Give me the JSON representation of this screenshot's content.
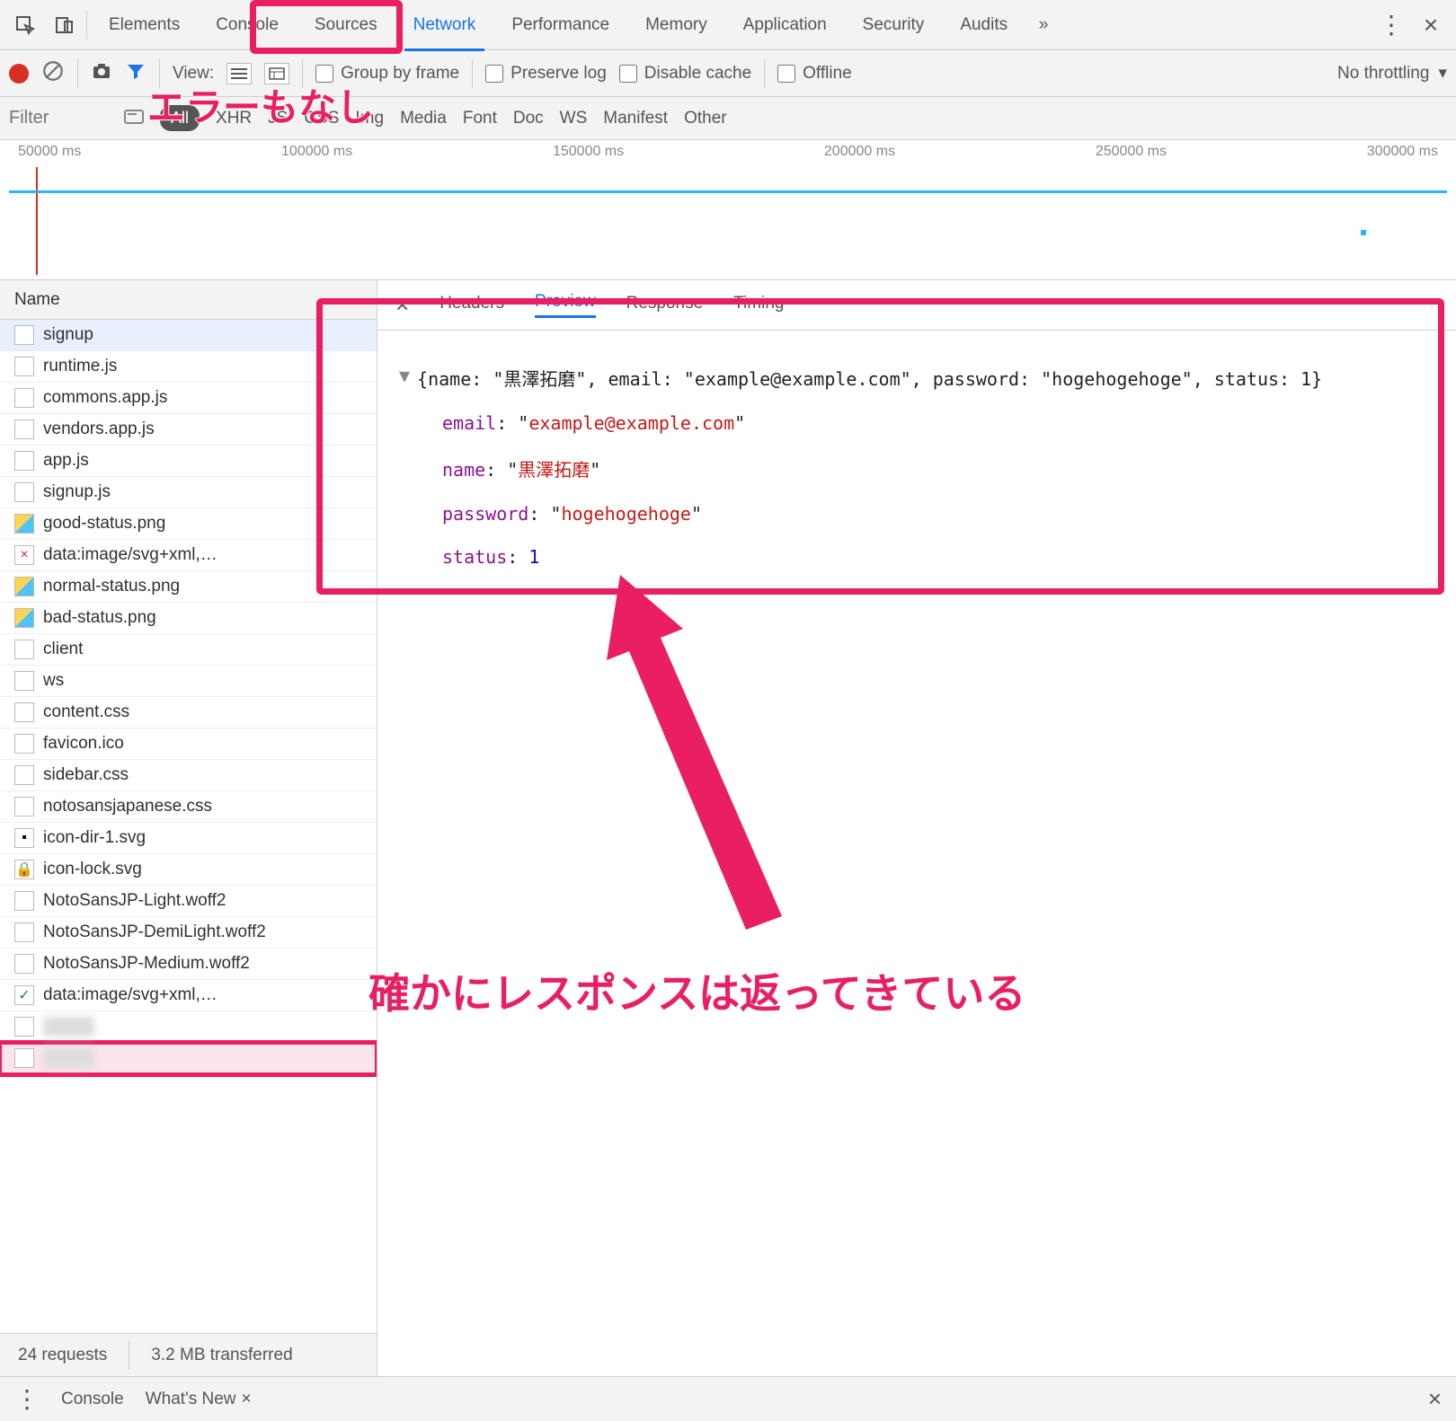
{
  "tabs": {
    "elements": "Elements",
    "console": "Console",
    "sources": "Sources",
    "network": "Network",
    "performance": "Performance",
    "memory": "Memory",
    "application": "Application",
    "security": "Security",
    "audits": "Audits"
  },
  "toolbar": {
    "view_label": "View:",
    "group_by_frame": "Group by frame",
    "preserve_log": "Preserve log",
    "disable_cache": "Disable cache",
    "offline": "Offline",
    "throttling": "No throttling"
  },
  "filter": {
    "placeholder": "Filter",
    "types": {
      "all": "All",
      "xhr": "XHR",
      "js": "JS",
      "css": "CSS",
      "img": "Img",
      "media": "Media",
      "font": "Font",
      "doc": "Doc",
      "ws": "WS",
      "manifest": "Manifest",
      "other": "Other"
    }
  },
  "timeline": {
    "ticks": [
      "50000 ms",
      "100000 ms",
      "150000 ms",
      "200000 ms",
      "250000 ms",
      "300000 ms"
    ]
  },
  "name_header": "Name",
  "requests": [
    {
      "name": "signup",
      "icon": "doc",
      "selected": true
    },
    {
      "name": "runtime.js",
      "icon": "doc"
    },
    {
      "name": "commons.app.js",
      "icon": "doc"
    },
    {
      "name": "vendors.app.js",
      "icon": "doc"
    },
    {
      "name": "app.js",
      "icon": "doc"
    },
    {
      "name": "signup.js",
      "icon": "doc"
    },
    {
      "name": "good-status.png",
      "icon": "img"
    },
    {
      "name": "data:image/svg+xml,…",
      "icon": "x"
    },
    {
      "name": "normal-status.png",
      "icon": "img"
    },
    {
      "name": "bad-status.png",
      "icon": "img"
    },
    {
      "name": "client",
      "icon": "doc"
    },
    {
      "name": "ws",
      "icon": "doc"
    },
    {
      "name": "content.css",
      "icon": "doc"
    },
    {
      "name": "favicon.ico",
      "icon": "doc"
    },
    {
      "name": "sidebar.css",
      "icon": "doc"
    },
    {
      "name": "notosansjapanese.css",
      "icon": "doc"
    },
    {
      "name": "icon-dir-1.svg",
      "icon": "svg"
    },
    {
      "name": "icon-lock.svg",
      "icon": "lock"
    },
    {
      "name": "NotoSansJP-Light.woff2",
      "icon": "doc"
    },
    {
      "name": "NotoSansJP-DemiLight.woff2",
      "icon": "doc"
    },
    {
      "name": "NotoSansJP-Medium.woff2",
      "icon": "doc"
    },
    {
      "name": "data:image/svg+xml,…",
      "icon": "chk"
    },
    {
      "name": "hidden",
      "icon": "doc",
      "blur": true
    },
    {
      "name": "hidden",
      "icon": "doc",
      "blur": true,
      "highlighted": true
    }
  ],
  "detail": {
    "tabs": {
      "headers": "Headers",
      "preview": "Preview",
      "response": "Response",
      "timing": "Timing"
    },
    "summary": "{name: \"黒澤拓磨\", email: \"example@example.com\", password: \"hogehogehoge\", status: 1}",
    "body": {
      "email_k": "email",
      "email_v": "example@example.com",
      "name_k": "name",
      "name_v": "黒澤拓磨",
      "password_k": "password",
      "password_v": "hogehogehoge",
      "status_k": "status",
      "status_v": "1"
    }
  },
  "summary": {
    "requests": "24 requests",
    "transferred": "3.2 MB transferred"
  },
  "drawer": {
    "console": "Console",
    "whats_new": "What's New"
  },
  "annotations": {
    "no_error": "エラーもなし",
    "response_ok": "確かにレスポンスは返ってきている"
  },
  "glyphs": {
    "overflow": "»",
    "close": "×",
    "dots": "⋮",
    "tri_down": "▼",
    "dropdown": "▾",
    "check": "✓",
    "cross": "×",
    "lock": "🔒",
    "svg": "▪"
  }
}
